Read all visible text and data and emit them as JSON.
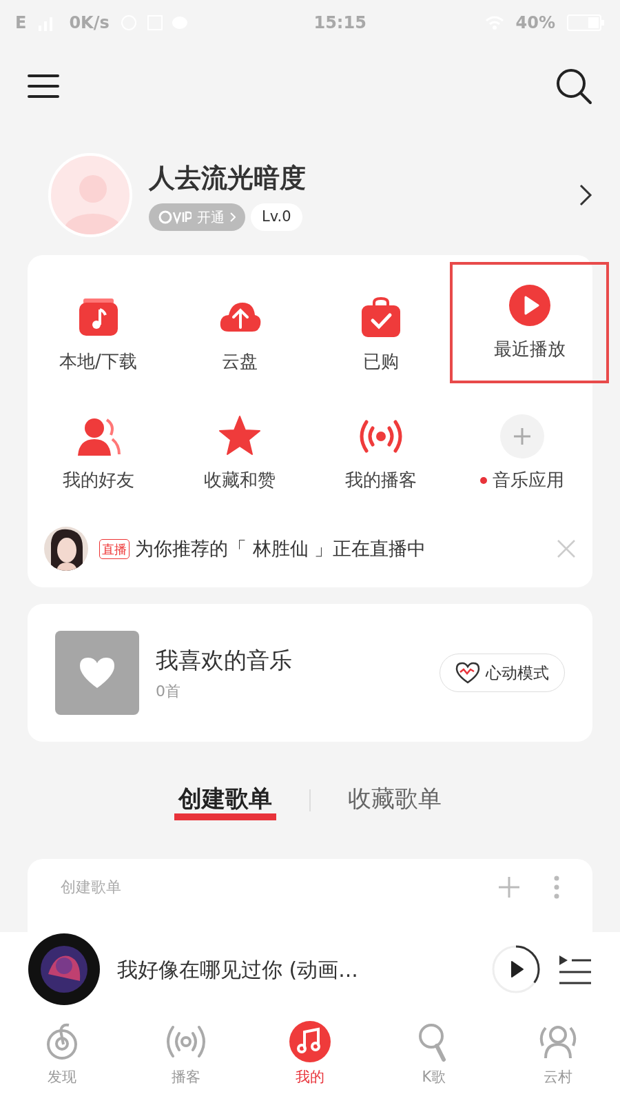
{
  "status_bar": {
    "network": "E",
    "speed": "0K/s",
    "time": "15:15",
    "battery": "40%"
  },
  "profile": {
    "name": "人去流光暗度",
    "vip": "开通",
    "level_badge": "Lv.0"
  },
  "shortcuts": [
    {
      "kind": "local",
      "label": "本地/下载",
      "dot": false,
      "highlighted": false
    },
    {
      "kind": "cloud",
      "label": "云盘",
      "dot": false,
      "highlighted": false
    },
    {
      "kind": "bag",
      "label": "已购",
      "dot": false,
      "highlighted": false
    },
    {
      "kind": "play",
      "label": "最近播放",
      "dot": false,
      "highlighted": true
    },
    {
      "kind": "friends",
      "label": "我的好友",
      "dot": false,
      "highlighted": false
    },
    {
      "kind": "star",
      "label": "收藏和赞",
      "dot": false,
      "highlighted": false
    },
    {
      "kind": "podcast",
      "label": "我的播客",
      "dot": false,
      "highlighted": false
    },
    {
      "kind": "add",
      "label": "音乐应用",
      "dot": true,
      "highlighted": false
    }
  ],
  "live": {
    "badge": "直播",
    "text": "为你推荐的「 林胜仙 」正在直播中"
  },
  "favorites": {
    "title": "我喜欢的音乐",
    "count": "0首",
    "button": "心动模式"
  },
  "tabs": [
    {
      "label": "创建歌单",
      "selected": true
    },
    {
      "label": "收藏歌单",
      "selected": false
    }
  ],
  "playlist_card": {
    "title": "创建歌单"
  },
  "player": {
    "title": "我好像在哪见过你 (动画...",
    "level": 0.35
  },
  "nav": [
    {
      "kind": "discover",
      "label": "发现",
      "selected": false
    },
    {
      "kind": "podcast",
      "label": "播客",
      "selected": false
    },
    {
      "kind": "mine",
      "label": "我的",
      "selected": true
    },
    {
      "kind": "karaoke",
      "label": "K歌",
      "selected": false
    },
    {
      "kind": "village",
      "label": "云村",
      "selected": false
    }
  ]
}
